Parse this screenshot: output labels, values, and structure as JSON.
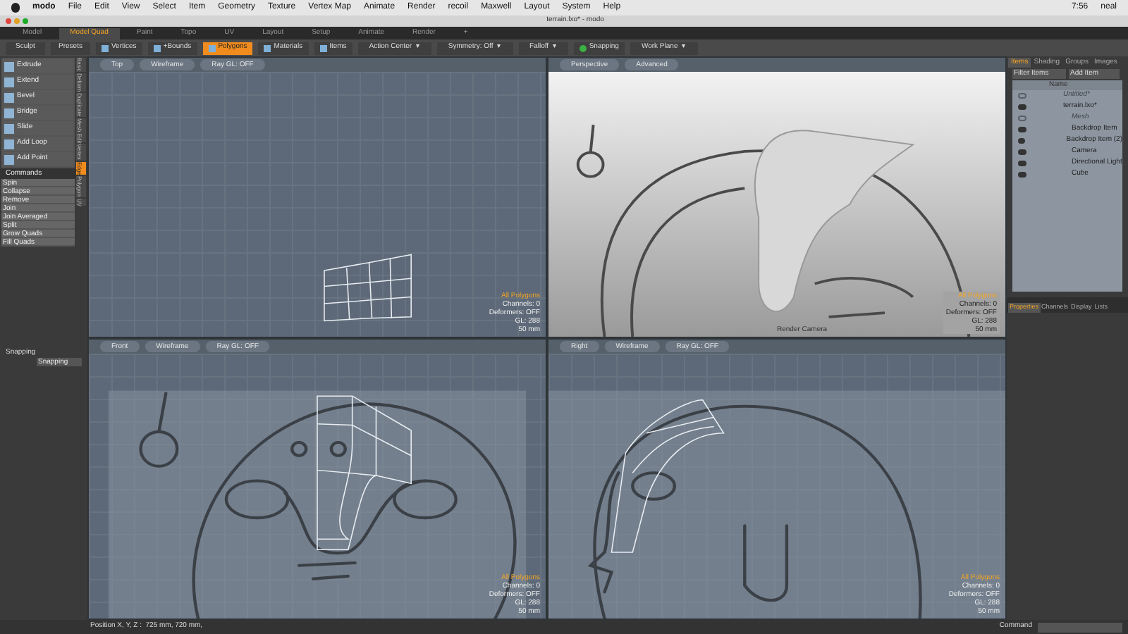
{
  "menubar": {
    "items": [
      "modo",
      "File",
      "Edit",
      "View",
      "Select",
      "Item",
      "Geometry",
      "Texture",
      "Vertex Map",
      "Animate",
      "Render",
      "recoil",
      "Maxwell",
      "Layout",
      "System",
      "Help"
    ],
    "clock": "7:56",
    "user": "neal"
  },
  "window": {
    "title": "terrain.lxo* - modo"
  },
  "layout_tabs": [
    {
      "label": "Model",
      "selected": false
    },
    {
      "label": "Model Quad",
      "selected": true
    },
    {
      "label": "Paint",
      "selected": false
    },
    {
      "label": "Topo",
      "selected": false
    },
    {
      "label": "UV",
      "selected": false
    },
    {
      "label": "Layout",
      "selected": false
    },
    {
      "label": "Setup",
      "selected": false
    },
    {
      "label": "Animate",
      "selected": false
    },
    {
      "label": "Render",
      "selected": false
    },
    {
      "label": "+",
      "selected": false
    }
  ],
  "toolbar": {
    "left": [
      "Sculpt",
      "Presets"
    ],
    "modes": [
      {
        "label": "Vertices",
        "selected": false
      },
      {
        "label": "+Bounds",
        "selected": false
      },
      {
        "label": "Polygons",
        "selected": true
      },
      {
        "label": "Materials",
        "selected": false
      },
      {
        "label": "Items",
        "selected": false
      }
    ],
    "dropdowns": [
      "Action Center",
      "Symmetry: Off",
      "Falloff"
    ],
    "snapping": "Snapping",
    "work_plane": "Work Plane",
    "caret": "▾"
  },
  "tools": [
    "Extrude",
    "Extend",
    "Bevel",
    "Bridge",
    "Slide",
    "Add Loop",
    "Add Point"
  ],
  "commands": {
    "title": "Commands",
    "items": [
      "Spin",
      "Collapse",
      "Remove",
      "Join",
      "Join Averaged",
      "Split",
      "Grow Quads",
      "Fill Quads"
    ]
  },
  "side_tabs": [
    {
      "label": "Basic",
      "selected": false
    },
    {
      "label": "Deform",
      "selected": false
    },
    {
      "label": "Duplicate",
      "selected": false
    },
    {
      "label": "Mesh Edit",
      "selected": false
    },
    {
      "label": "Vertex",
      "selected": false
    },
    {
      "label": "Edge",
      "selected": true
    },
    {
      "label": "Polygon",
      "selected": false
    },
    {
      "label": "UV",
      "selected": false
    }
  ],
  "snapping": {
    "title": "Snapping",
    "field": "Snapping"
  },
  "viewports": [
    {
      "kind": "top",
      "view": "Top",
      "shading": "Wireframe",
      "raygl": "Ray GL: OFF",
      "info": [
        "All Polygons",
        "Channels: 0",
        "Deformers: OFF",
        "GL: 288",
        "50 mm"
      ]
    },
    {
      "kind": "perspective",
      "view": "Perspective",
      "shading": "Advanced",
      "camera": "Render Camera",
      "info": [
        "All Polygons",
        "Channels: 0",
        "Deformers: OFF",
        "GL: 288",
        "50 mm"
      ]
    },
    {
      "kind": "front",
      "view": "Front",
      "shading": "Wireframe",
      "raygl": "Ray GL: OFF",
      "info": [
        "All Polygons",
        "Channels: 0",
        "Deformers: OFF",
        "GL: 288",
        "50 mm"
      ]
    },
    {
      "kind": "side",
      "view": "Right",
      "shading": "Wireframe",
      "raygl": "Ray GL: OFF",
      "info": [
        "All Polygons",
        "Channels: 0",
        "Deformers: OFF",
        "GL: 288",
        "50 mm"
      ]
    }
  ],
  "items_panel": {
    "tabs": [
      {
        "label": "Items",
        "selected": true
      },
      {
        "label": "Shading",
        "selected": false
      },
      {
        "label": "Groups",
        "selected": false
      },
      {
        "label": "Images",
        "selected": false
      }
    ],
    "filter": "Filter Items",
    "add": "Add Item",
    "column": "Name",
    "tree": [
      {
        "label": "Untitled*",
        "visible": false
      },
      {
        "label": "terrain.lxo*",
        "visible": true,
        "children": [
          {
            "label": "Mesh",
            "visible": false
          },
          {
            "label": "Backdrop Item",
            "visible": true
          },
          {
            "label": "Backdrop Item (2)",
            "visible": true
          },
          {
            "label": "Camera",
            "visible": true
          },
          {
            "label": "Directional Light",
            "visible": true
          },
          {
            "label": "Cube",
            "visible": true
          }
        ]
      }
    ]
  },
  "properties_tabs": [
    {
      "label": "Properties",
      "selected": true
    },
    {
      "label": "Channels",
      "selected": false
    },
    {
      "label": "Display",
      "selected": false
    },
    {
      "label": "Lists",
      "selected": false
    }
  ],
  "status_bar": {
    "position": "Position X, Y, Z :  725 mm, 720 mm,",
    "command": "Command"
  }
}
